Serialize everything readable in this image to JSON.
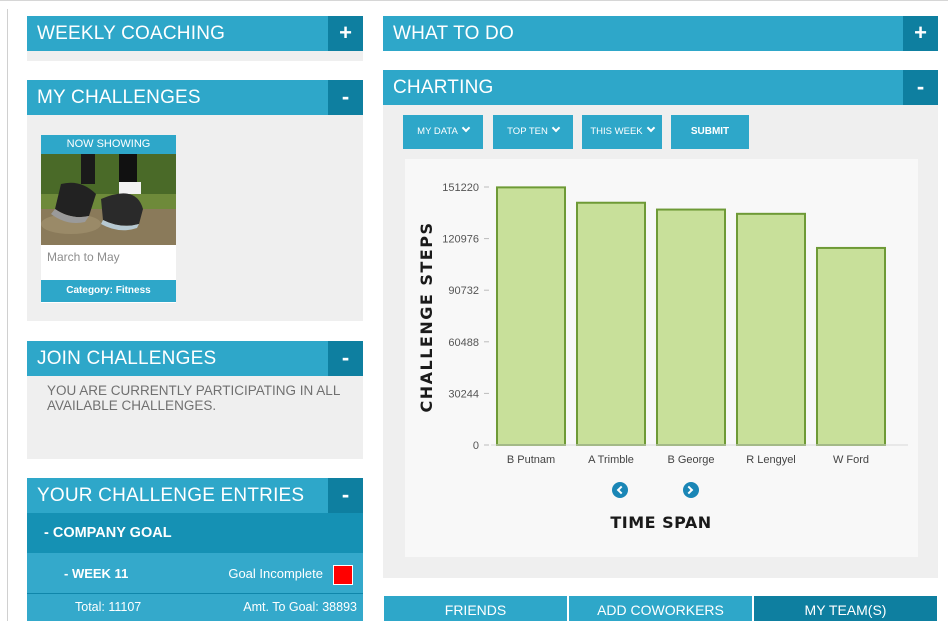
{
  "left": {
    "weekly_coaching": {
      "title": "WEEKLY COACHING",
      "toggle": "+"
    },
    "my_challenges": {
      "title": "MY CHALLENGES",
      "toggle": "-",
      "card": {
        "badge": "NOW SHOWING",
        "period": "March to May",
        "category": "Category: Fitness"
      }
    },
    "join_challenges": {
      "title": "JOIN CHALLENGES",
      "toggle": "-",
      "message": "YOU ARE CURRENTLY PARTICIPATING IN ALL AVAILABLE CHALLENGES."
    },
    "entries": {
      "title": "YOUR CHALLENGE ENTRIES",
      "toggle": "-",
      "goal": "- COMPANY GOAL",
      "week": "- WEEK 11",
      "status": "Goal Incomplete",
      "status_color": "#ff0000",
      "total": "Total: 11107",
      "amt_to_goal": "Amt. To Goal: 38893"
    }
  },
  "right": {
    "what_to_do": {
      "title": "WHAT TO DO",
      "toggle": "+"
    },
    "charting": {
      "title": "CHARTING",
      "toggle": "-",
      "filters": [
        "MY DATA",
        "TOP TEN",
        "THIS WEEK"
      ],
      "submit": "SUBMIT"
    },
    "tabs": [
      "FRIENDS",
      "ADD COWORKERS",
      "MY TEAM(S)"
    ]
  },
  "colors": {
    "accent": "#2ea7c9",
    "accent_dark": "#0e7fa0",
    "bar_fill": "#c8e09a",
    "bar_stroke": "#6e9a36"
  },
  "chart_data": {
    "type": "bar",
    "categories": [
      "B Putnam",
      "A Trimble",
      "B George",
      "R Lengyel",
      "W Ford"
    ],
    "values": [
      151000,
      142000,
      138000,
      135500,
      115500
    ],
    "ylabel": "CHALLENGE STEPS",
    "xlabel": "TIME SPAN",
    "yticks": [
      0,
      30244,
      60488,
      90732,
      120976,
      151220
    ],
    "ylim": [
      0,
      151220
    ],
    "grid": false
  }
}
